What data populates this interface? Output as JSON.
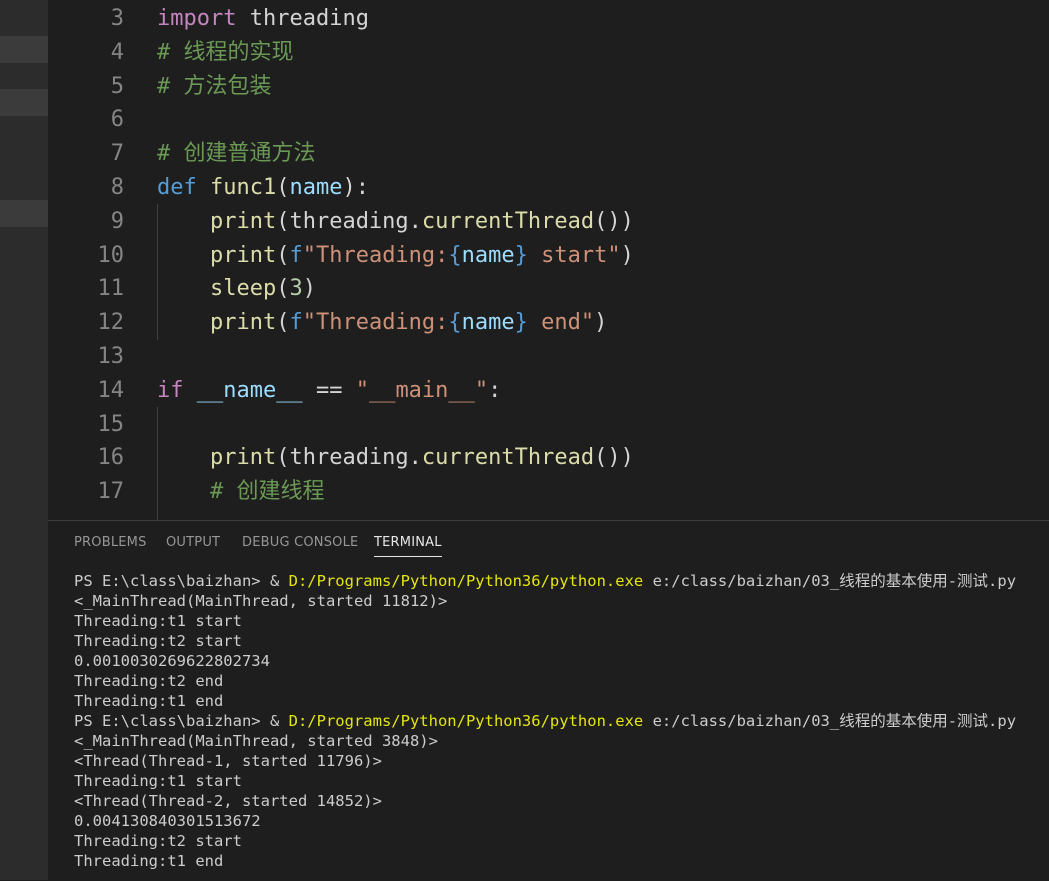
{
  "editor": {
    "lines": [
      {
        "n": "3",
        "parts": [
          [
            "kw-purple",
            "import"
          ],
          [
            "op",
            " threading"
          ]
        ]
      },
      {
        "n": "4",
        "parts": [
          [
            "cmt",
            "# 线程的实现"
          ]
        ]
      },
      {
        "n": "5",
        "parts": [
          [
            "cmt",
            "# 方法包装"
          ]
        ]
      },
      {
        "n": "6",
        "parts": []
      },
      {
        "n": "7",
        "parts": [
          [
            "cmt",
            "# 创建普通方法"
          ]
        ]
      },
      {
        "n": "8",
        "parts": [
          [
            "kw-blue",
            "def"
          ],
          [
            "op",
            " "
          ],
          [
            "fn",
            "func1"
          ],
          [
            "op",
            "("
          ],
          [
            "param",
            "name"
          ],
          [
            "op",
            "):"
          ]
        ]
      },
      {
        "n": "9",
        "parts": [
          [
            "op",
            "    "
          ],
          [
            "fn",
            "print"
          ],
          [
            "op",
            "(threading."
          ],
          [
            "fn",
            "currentThread"
          ],
          [
            "op",
            "())"
          ]
        ]
      },
      {
        "n": "10",
        "parts": [
          [
            "op",
            "    "
          ],
          [
            "fn",
            "print"
          ],
          [
            "op",
            "("
          ],
          [
            "kw-blue",
            "f"
          ],
          [
            "str",
            "\"Threading:"
          ],
          [
            "kw-blue",
            "{"
          ],
          [
            "param",
            "name"
          ],
          [
            "kw-blue",
            "}"
          ],
          [
            "str",
            " start\""
          ],
          [
            "op",
            ")"
          ]
        ]
      },
      {
        "n": "11",
        "parts": [
          [
            "op",
            "    "
          ],
          [
            "fn",
            "sleep"
          ],
          [
            "op",
            "("
          ],
          [
            "num",
            "3"
          ],
          [
            "op",
            ")"
          ]
        ]
      },
      {
        "n": "12",
        "parts": [
          [
            "op",
            "    "
          ],
          [
            "fn",
            "print"
          ],
          [
            "op",
            "("
          ],
          [
            "kw-blue",
            "f"
          ],
          [
            "str",
            "\"Threading:"
          ],
          [
            "kw-blue",
            "{"
          ],
          [
            "param",
            "name"
          ],
          [
            "kw-blue",
            "}"
          ],
          [
            "str",
            " end\""
          ],
          [
            "op",
            ")"
          ]
        ]
      },
      {
        "n": "13",
        "parts": []
      },
      {
        "n": "14",
        "parts": [
          [
            "kw-purple",
            "if"
          ],
          [
            "op",
            " "
          ],
          [
            "param",
            "__name__"
          ],
          [
            "op",
            " == "
          ],
          [
            "str",
            "\"__main__\""
          ],
          [
            "op",
            ":"
          ]
        ]
      },
      {
        "n": "15",
        "parts": []
      },
      {
        "n": "16",
        "parts": [
          [
            "op",
            "    "
          ],
          [
            "fn",
            "print"
          ],
          [
            "op",
            "(threading."
          ],
          [
            "fn",
            "currentThread"
          ],
          [
            "op",
            "())"
          ]
        ]
      },
      {
        "n": "17",
        "parts": [
          [
            "op",
            "    "
          ],
          [
            "cmt",
            "# 创建线程"
          ]
        ]
      }
    ]
  },
  "panel": {
    "tabs": [
      {
        "label": "PROBLEMS",
        "active": false
      },
      {
        "label": "OUTPUT",
        "active": false
      },
      {
        "label": "DEBUG CONSOLE",
        "active": false
      },
      {
        "label": "TERMINAL",
        "active": true
      }
    ]
  },
  "terminal": {
    "lines": [
      [
        [
          "",
          "PS E:\\class\\baizhan> & "
        ],
        [
          "yellow",
          "D:/Programs/Python/Python36/python.exe"
        ],
        [
          "",
          " e:/class/baizhan/03_线程的基本使用-测试.py"
        ]
      ],
      [
        [
          "",
          "<_MainThread(MainThread, started 11812)>"
        ]
      ],
      [
        [
          "",
          "Threading:t1 start"
        ]
      ],
      [
        [
          "",
          "Threading:t2 start"
        ]
      ],
      [
        [
          "",
          "0.0010030269622802734"
        ]
      ],
      [
        [
          "",
          "Threading:t2 end"
        ]
      ],
      [
        [
          "",
          "Threading:t1 end"
        ]
      ],
      [
        [
          "",
          "PS E:\\class\\baizhan> & "
        ],
        [
          "yellow",
          "D:/Programs/Python/Python36/python.exe"
        ],
        [
          "",
          " e:/class/baizhan/03_线程的基本使用-测试.py"
        ]
      ],
      [
        [
          "",
          "<_MainThread(MainThread, started 3848)>"
        ]
      ],
      [
        [
          "",
          "<Thread(Thread-1, started 11796)>"
        ]
      ],
      [
        [
          "",
          "Threading:t1 start"
        ]
      ],
      [
        [
          "",
          "<Thread(Thread-2, started 14852)>"
        ]
      ],
      [
        [
          "",
          "0.004130840301513672"
        ]
      ],
      [
        [
          "",
          "Threading:t2 start"
        ]
      ],
      [
        [
          "",
          "Threading:t1 end"
        ]
      ]
    ]
  }
}
